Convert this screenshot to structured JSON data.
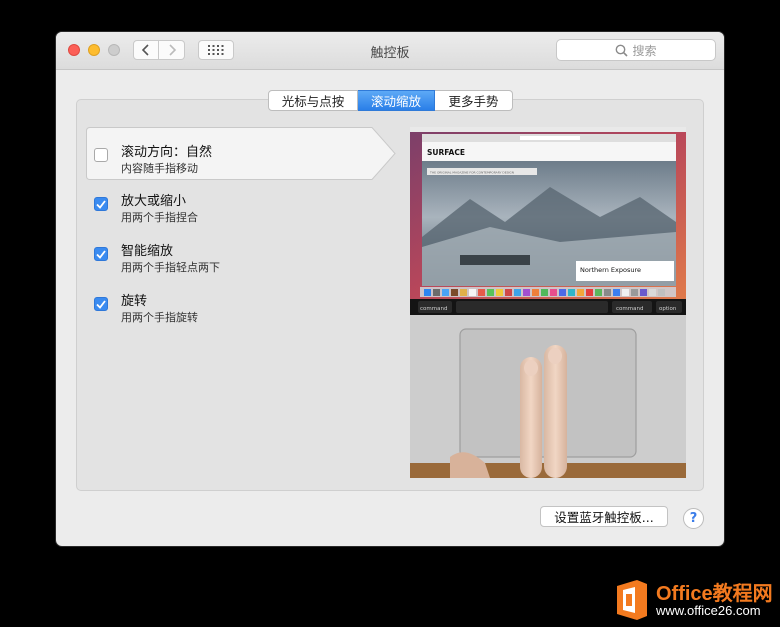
{
  "window": {
    "title": "触控板"
  },
  "search": {
    "placeholder": "搜索"
  },
  "tabs": [
    {
      "label": "光标与点按",
      "selected": false
    },
    {
      "label": "滚动缩放",
      "selected": true
    },
    {
      "label": "更多手势",
      "selected": false
    }
  ],
  "options": [
    {
      "title": "滚动方向：自然",
      "subtitle": "内容随手指移动",
      "checked": false,
      "highlighted": true
    },
    {
      "title": "放大或缩小",
      "subtitle": "用两个手指捏合",
      "checked": true
    },
    {
      "title": "智能缩放",
      "subtitle": "用两个手指轻点两下",
      "checked": true
    },
    {
      "title": "旋转",
      "subtitle": "用两个手指旋转",
      "checked": true
    }
  ],
  "preview": {
    "site_name": "SURFACE",
    "site_tagline": "THE ORIGINAL MAGAZINE FOR CONTEMPORARY DESIGN",
    "article_title": "Northern Exposure",
    "url": "surfacemag.com",
    "keys": [
      "command",
      "command",
      "option"
    ]
  },
  "footer": {
    "bluetooth_button": "设置蓝牙触控板...",
    "help": "?"
  },
  "watermark": {
    "brand": "Office教程网",
    "url": "www.office26.com"
  },
  "colors": {
    "accent": "#3a8bf0",
    "close": "#fc5f57",
    "minimize": "#fdbc2e",
    "watermark": "#f37a1f"
  }
}
